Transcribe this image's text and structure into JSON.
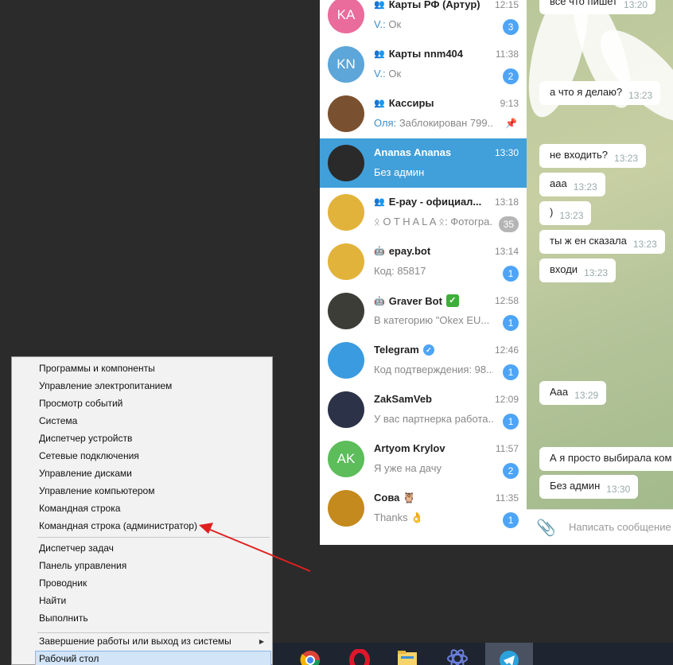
{
  "chat_list": [
    {
      "name": "Карты РФ (Артур)",
      "type": "group",
      "time": "12:15",
      "sender": "V.:",
      "preview": "Ок",
      "badge": "3",
      "avatar": {
        "initials": "KA",
        "color": "#e96c9c"
      }
    },
    {
      "name": "Карты nnm404",
      "type": "group",
      "time": "11:38",
      "sender": "V.:",
      "preview": "Ок",
      "badge": "2",
      "avatar": {
        "initials": "KN",
        "color": "#5da6d9"
      }
    },
    {
      "name": "Кассиры",
      "type": "group",
      "time": "9:13",
      "sender": "Оля:",
      "preview": "Заблокирован 799...",
      "badge": "",
      "pinned": true,
      "avatar": {
        "initials": "",
        "color": "#7a5130"
      }
    },
    {
      "name": "Ananas Ananas",
      "type": "user",
      "time": "13:30",
      "sender": "",
      "preview": "Без админ",
      "badge": "",
      "active": true,
      "avatar": {
        "initials": "",
        "color": "#2a2a2a"
      }
    },
    {
      "name": "E-pay - официал...",
      "type": "channel",
      "time": "13:18",
      "sender": "",
      "preview": "ᛟ O T H A L A ᛟ: Фотогра...",
      "badge": "35",
      "muted": true,
      "avatar": {
        "initials": "",
        "color": "#e2b33a"
      }
    },
    {
      "name": "epay.bot",
      "type": "bot",
      "time": "13:14",
      "sender": "",
      "preview": "Код: 85817",
      "badge": "1",
      "avatar": {
        "initials": "",
        "color": "#e2b33a"
      }
    },
    {
      "name": "Graver Bot",
      "type": "bot",
      "time": "12:58",
      "sender": "",
      "preview": "В категорию \"Okex EU...",
      "badge": "1",
      "avatar": {
        "initials": "",
        "color": "#3b3d36"
      }
    },
    {
      "name": "Telegram",
      "type": "verified",
      "time": "12:46",
      "sender": "",
      "preview": "Код подтверждения: 98...",
      "badge": "1",
      "avatar": {
        "initials": "",
        "color": "#3a9be0"
      }
    },
    {
      "name": "ZakSamVeb",
      "type": "user",
      "time": "12:09",
      "sender": "",
      "preview": "У вас партнерка работа...",
      "badge": "1",
      "avatar": {
        "initials": "",
        "color": "#2c3348"
      }
    },
    {
      "name": "Artyom Krylov",
      "type": "user",
      "time": "11:57",
      "sender": "",
      "preview": "Я уже на дачу",
      "badge": "2",
      "avatar": {
        "initials": "AK",
        "color": "#5cbd5a"
      }
    },
    {
      "name": "Сова 🦉",
      "type": "user",
      "time": "11:35",
      "sender": "",
      "preview": "Thanks 👌",
      "badge": "1",
      "avatar": {
        "initials": "",
        "color": "#c58a1d"
      }
    }
  ],
  "messages": [
    {
      "text": "а что я делаю?",
      "time": "13:23"
    },
    {
      "text": "не входить?",
      "time": "13:23"
    },
    {
      "text": "aaa",
      "time": "13:23"
    },
    {
      "text": ")",
      "time": "13:23"
    },
    {
      "text": "ты ж ен сказала",
      "time": "13:23"
    },
    {
      "text": "входи",
      "time": "13:23"
    },
    {
      "text": "Aaa",
      "time": "13:29"
    },
    {
      "text": "А я просто выбирала ком",
      "time": ""
    },
    {
      "text": "Без админ",
      "time": "13:30"
    }
  ],
  "top_partial": {
    "text": "всё что пишет",
    "time": "13:20"
  },
  "input": {
    "placeholder": "Написать сообщение"
  },
  "win_menu": {
    "group1": [
      "Программы и компоненты",
      "Управление электропитанием",
      "Просмотр событий",
      "Система",
      "Диспетчер устройств",
      "Сетевые подключения",
      "Управление дисками",
      "Управление компьютером",
      "Командная строка",
      "Командная строка (администратор)"
    ],
    "group2": [
      "Диспетчер задач",
      "Панель управления",
      "Проводник",
      "Найти",
      "Выполнить"
    ],
    "group3": [
      "Завершение работы или выход из системы",
      "Рабочий стол"
    ],
    "highlighted": "Рабочий стол"
  },
  "taskbar": {
    "icons": [
      "chrome-icon",
      "opera-icon",
      "explorer-icon",
      "atom-icon",
      "telegram-icon"
    ]
  },
  "colors": {
    "accent": "#419fd9",
    "badge": "#4ea4f6",
    "arrow": "#e02020"
  }
}
